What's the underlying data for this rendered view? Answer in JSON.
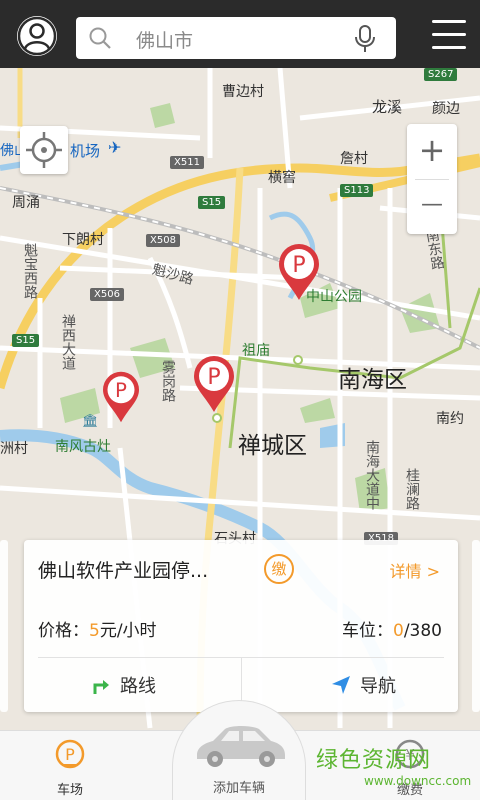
{
  "header": {
    "search_text": "佛山市",
    "avatar_icon": "user-icon",
    "mic_icon": "microphone-icon",
    "menu_icon": "hamburger-menu-icon"
  },
  "map": {
    "labels": {
      "caobiancun": "曹边村",
      "longxi": "龙溪",
      "yanbian": "颜边",
      "jichang": "机场",
      "foshan_prefix": "佛山",
      "cangcun": "詹村",
      "hengjiao": "横窖",
      "zhouyong": "周涌",
      "xialangcun": "下朗村",
      "kuishalu": "魁沙路",
      "kuibaoxilu": "魁宝西路",
      "zhongshangongyuan": "中山公园",
      "chandongjie": "南东路",
      "chanxidadao": "禅西大道",
      "zumiao": "祖庙",
      "nanhaiqu": "南海区",
      "wugangilu": "雾岗路",
      "nanfengguzao": "南风古灶",
      "zhoucun": "洲村",
      "chanchengqu": "禅城区",
      "nanyue": "南约",
      "nanhaidadaozhong": "南海大道中",
      "guilanlu": "桂澜路",
      "shidingcun": "石头村",
      "chaoqin": "潮"
    },
    "shields": {
      "x511": "X511",
      "s15_a": "S15",
      "s113": "S113",
      "x508": "X508",
      "x506": "X506",
      "s15_b": "S15",
      "s267": "S267",
      "x518": "X518"
    },
    "locate_icon": "locate-crosshair-icon",
    "zoom_in": "+",
    "zoom_out": "—"
  },
  "card": {
    "name": "佛山软件产业园停...",
    "pay_badge": "缴",
    "detail_link": "详情 >",
    "price_label": "价格：",
    "price_value": "5",
    "price_unit": "元/小时",
    "spots_label": "车位：",
    "spots_available": "0",
    "spots_total": "/380",
    "route_label": "路线",
    "nav_label": "导航"
  },
  "bottom_bar": {
    "tab_park": "车场",
    "tab_add_car": "添加车辆",
    "tab_pay": "缴费"
  },
  "watermark": {
    "title": "绿色资源网",
    "url": "www.downcc.com"
  },
  "colors": {
    "accent": "#f39a2b",
    "topbar": "#2b2b2b",
    "pin_red": "#d9393e",
    "road_yellow": "#f6cf61",
    "water": "#9fcbeb",
    "park_green": "#bcd8a4"
  }
}
